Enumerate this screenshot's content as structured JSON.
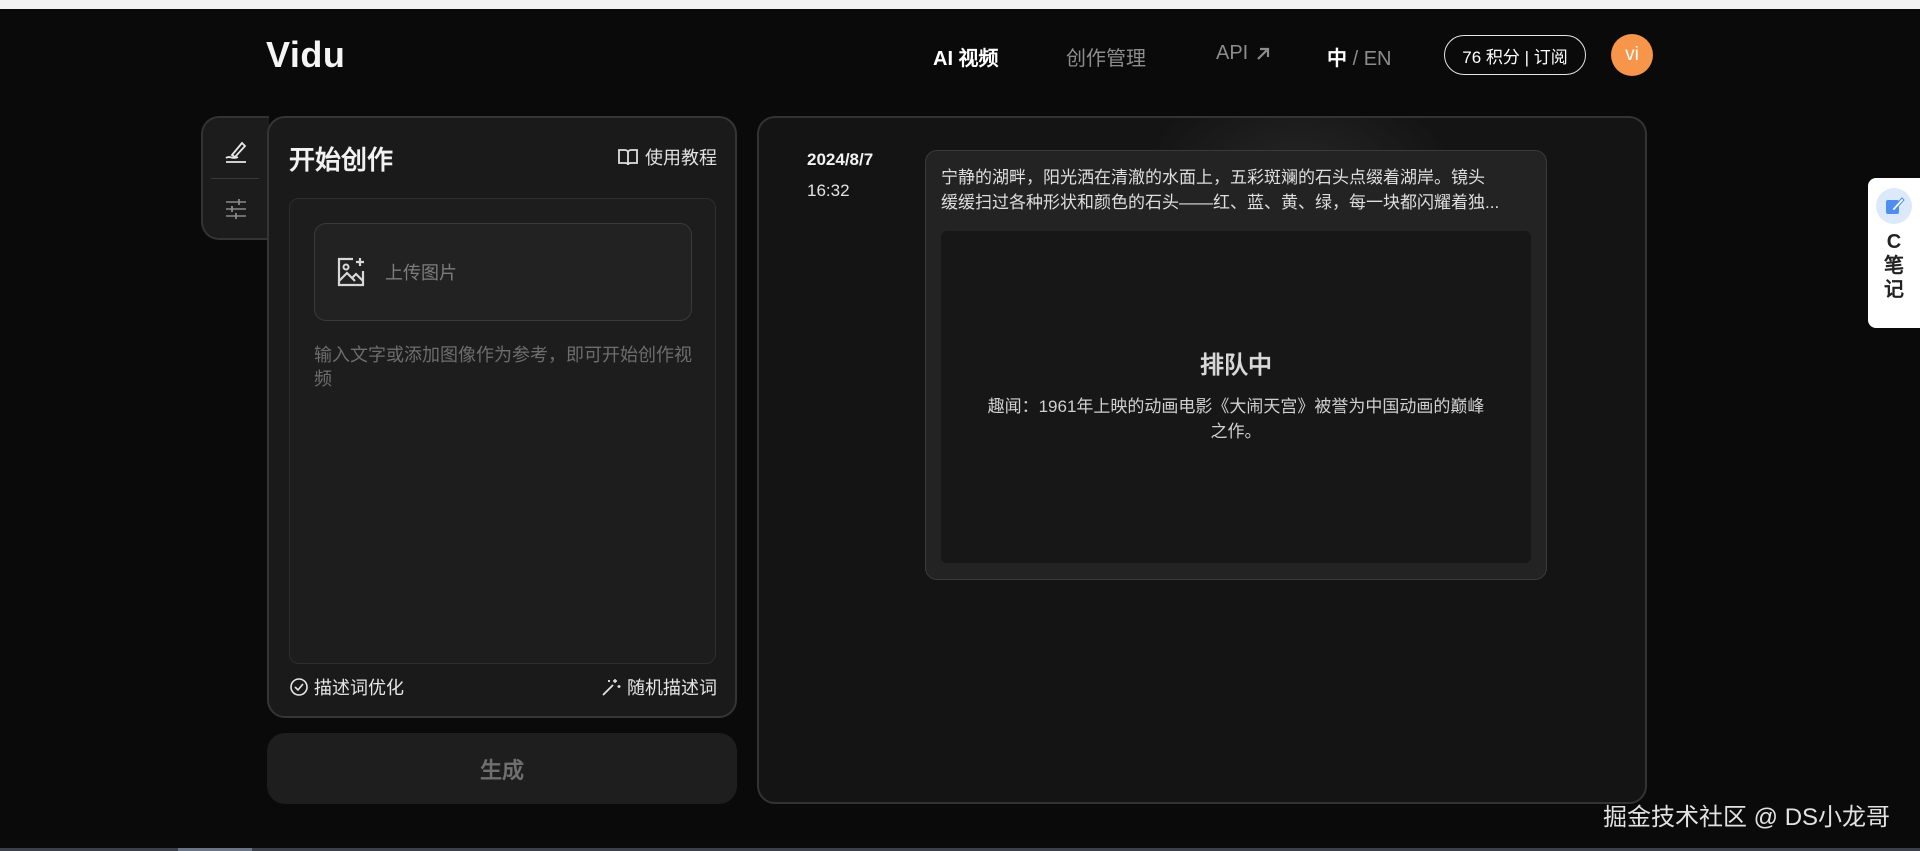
{
  "header": {
    "logo": "Vidu",
    "nav": {
      "ai_video": "AI 视频",
      "creation_manage": "创作管理",
      "api": "API",
      "lang_zh": "中",
      "lang_sep": "/",
      "lang_en": "EN"
    },
    "credits": "76 积分 | 订阅",
    "avatar": "vi"
  },
  "create": {
    "title": "开始创作",
    "tutorial": "使用教程",
    "upload_label": "上传图片",
    "prompt_placeholder": "输入文字或添加图像作为参考，即可开始创作视频",
    "optimize": "描述词优化",
    "random": "随机描述词",
    "generate": "生成"
  },
  "task": {
    "date": "2024/8/7",
    "time": "16:32",
    "prompt_line1": "宁静的湖畔，阳光洒在清澈的水面上，五彩斑斓的石头点缀着湖岸。镜头",
    "prompt_line2": "缓缓扫过各种形状和颜色的石头——红、蓝、黄、绿，每一块都闪耀着独...",
    "status": "排队中",
    "fun_fact": "趣闻：1961年上映的动画电影《大闹天宫》被誉为中国动画的巅峰之作。"
  },
  "note_widget": {
    "label": "C笔记"
  },
  "watermark": "掘金技术社区 @ DS小龙哥",
  "colors": {
    "accent_avatar": "#f7954a",
    "background": "#0a0a0a"
  }
}
